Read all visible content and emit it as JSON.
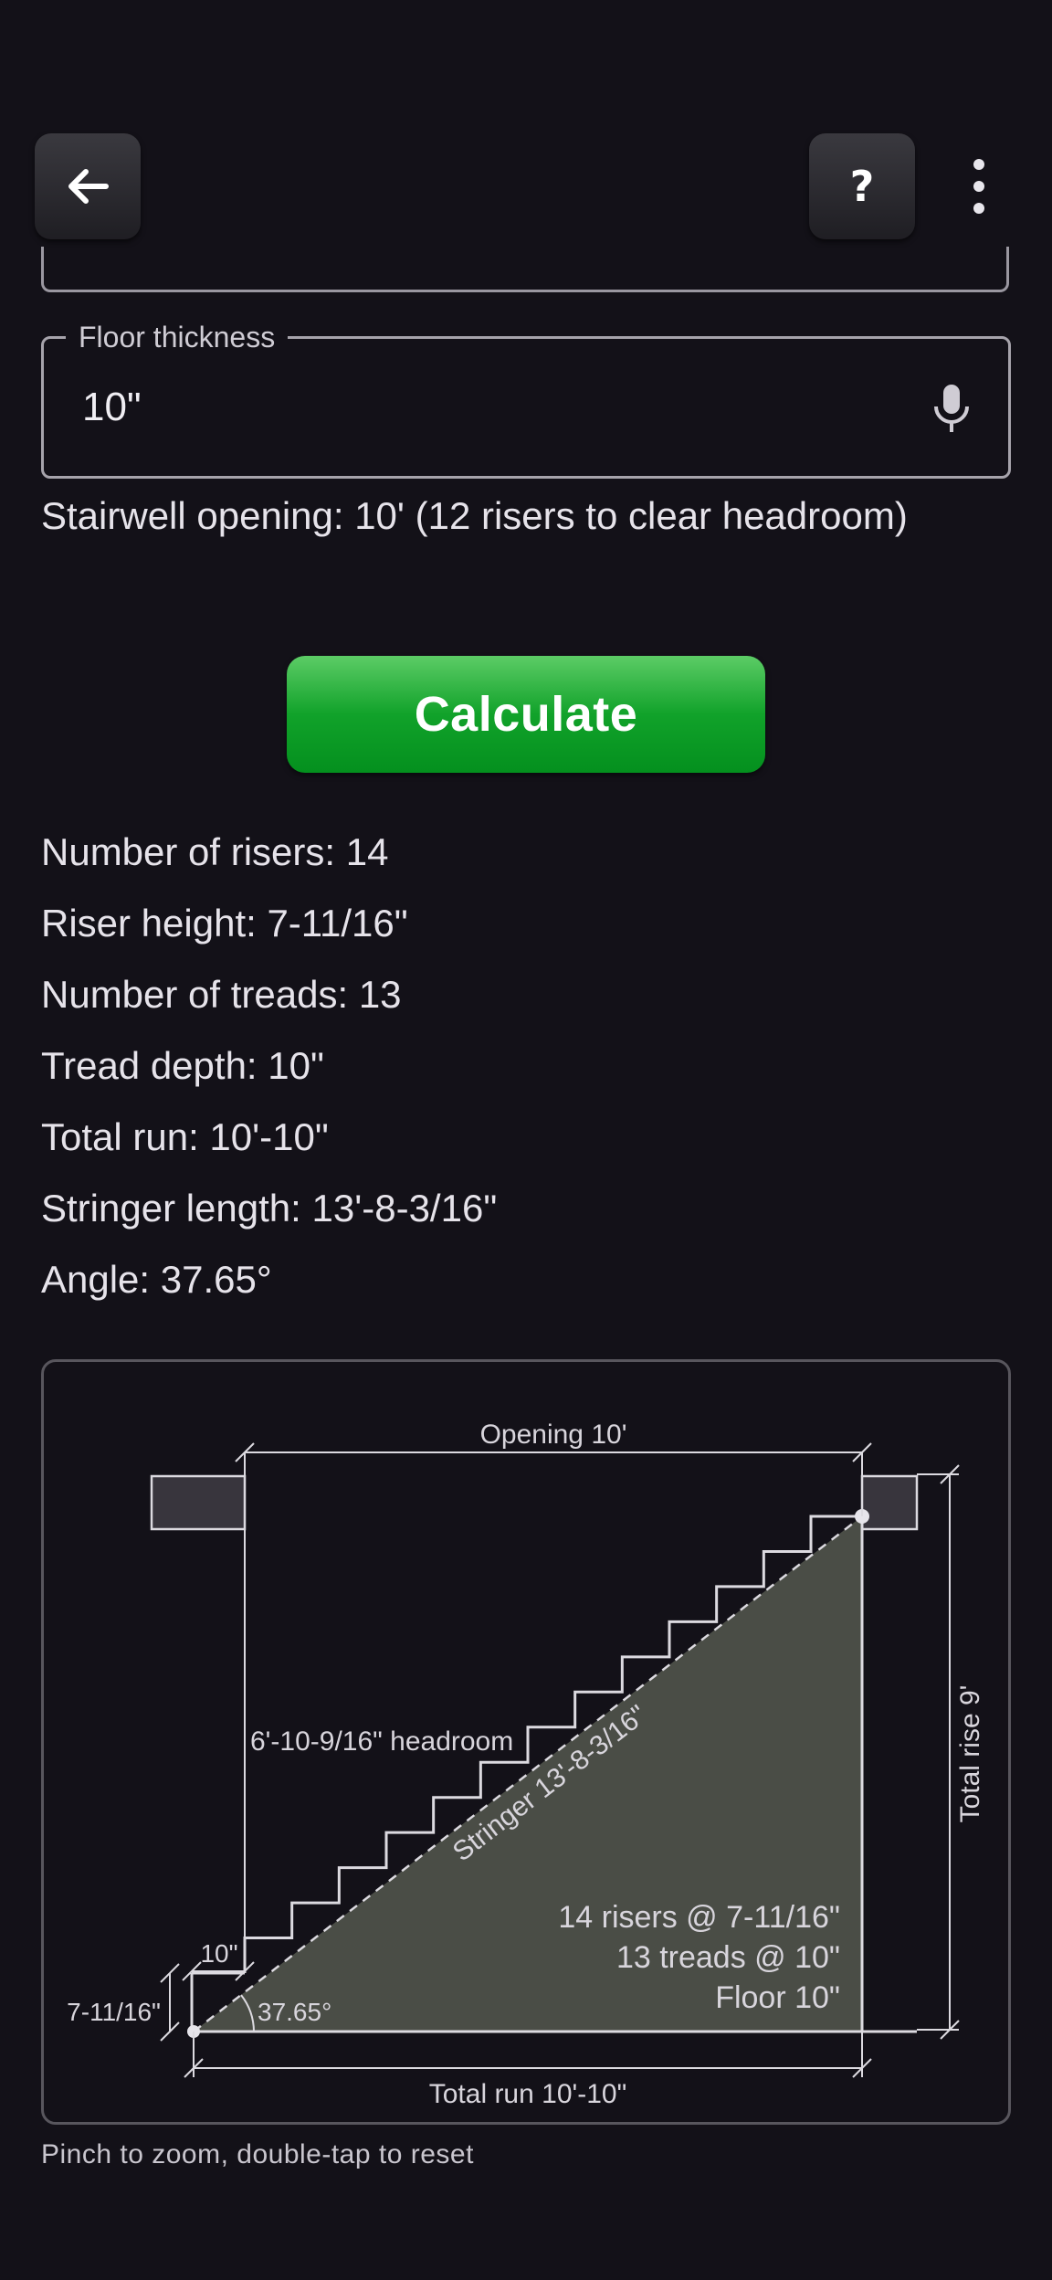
{
  "toolbar": {
    "back_icon": "arrow-left-icon",
    "help_label": "?",
    "more_icon": "vertical-dots-icon"
  },
  "form": {
    "floor_thickness": {
      "label": "Floor thickness",
      "value": "10\"",
      "icon": "microphone-icon"
    },
    "opening_note": "Stairwell opening: 10' (12 risers to clear headroom)",
    "calculate_label": "Calculate"
  },
  "results": [
    "Number of risers: 14",
    "Riser height: 7-11/16\"",
    "Number of treads: 13",
    "Tread depth: 10\"",
    "Total run: 10'-10\"",
    "Stringer length: 13'-8-3/16\"",
    "Angle: 37.65°"
  ],
  "diagram": {
    "opening_label": "Opening 10'",
    "total_rise_label": "Total rise 9'",
    "headroom_label": "6'-10-9/16\" headroom",
    "stringer_label": "Stringer 13'-8-3/16\"",
    "summary_risers": "14 risers @ 7-11/16\"",
    "summary_treads": "13 treads @ 10\"",
    "summary_floor": "Floor 10\"",
    "tread_label": "10\"",
    "riser_label": "7-11/16\"",
    "angle_label": "37.65°",
    "total_run_label": "Total run 10'-10\"",
    "risers": 14,
    "treads": 13,
    "colors": {
      "fill": "#4a4d46",
      "line": "#dcdae0",
      "floor_block": "#38353d"
    }
  },
  "hint": "Pinch to zoom, double-tap to reset"
}
